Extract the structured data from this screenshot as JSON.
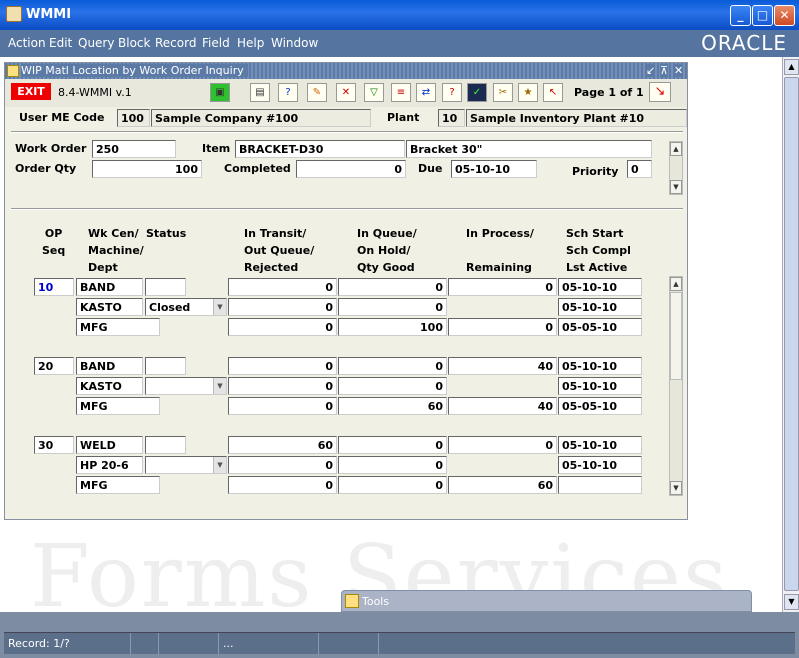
{
  "window": {
    "title": "WMMI",
    "min": "_",
    "max": "□",
    "close": "✕"
  },
  "menu": [
    "Action",
    "Edit",
    "Query",
    "Block",
    "Record",
    "Field",
    "Help",
    "Window"
  ],
  "brand": "ORACLE",
  "watermark": "Forms Services",
  "form": {
    "title": "WIP Matl Location by Work Order Inquiry",
    "title_controls": [
      "↙",
      "⊼",
      "✕"
    ],
    "exit_label": "EXIT",
    "form_code": "8.4-WMMI v.1",
    "page_indicator": "Page 1 of 1",
    "toolbar_icons": [
      "save-icon",
      "print-icon",
      "query-help-icon",
      "edit-icon",
      "delete-icon",
      "filter-icon",
      "report-icon",
      "navigate-icon",
      "help-icon",
      "select-icon",
      "tools-icon",
      "wizard-icon",
      "back-icon"
    ]
  },
  "header": {
    "user_me_code_label": "User ME Code",
    "user_me_code": "100",
    "company": "Sample Company #100",
    "plant_label": "Plant",
    "plant_code": "10",
    "plant_name": "Sample Inventory Plant #10"
  },
  "work_order": {
    "work_order_label": "Work Order",
    "work_order": "250",
    "item_label": "Item",
    "item": "BRACKET-D30",
    "item_desc": "Bracket 30\"",
    "order_qty_label": "Order Qty",
    "order_qty": "100",
    "completed_label": "Completed",
    "completed": "0",
    "due_label": "Due",
    "due": "05-10-10",
    "priority_label": "Priority",
    "priority": "0"
  },
  "columns": {
    "op": [
      "OP",
      "Seq"
    ],
    "wk": [
      "Wk Cen/",
      "Machine/",
      "Dept"
    ],
    "status": "Status",
    "transit": [
      "In Transit/",
      "Out Queue/",
      "Rejected"
    ],
    "queue": [
      "In Queue/",
      "On Hold/",
      "Qty Good"
    ],
    "process": [
      "In Process/",
      "",
      "Remaining"
    ],
    "sch": [
      "Sch Start",
      "Sch Compl",
      "Lst Active"
    ]
  },
  "ops": [
    {
      "seq": "10",
      "rows": [
        {
          "wk": "BAND",
          "status": "",
          "transit": "0",
          "queue": "0",
          "process": "0",
          "sch": "05-10-10"
        },
        {
          "wk": "KASTO",
          "status": "Closed",
          "transit": "0",
          "queue": "0",
          "process": "",
          "sch": "05-10-10"
        },
        {
          "wk": "MFG",
          "status": "",
          "transit": "0",
          "queue": "100",
          "process": "0",
          "sch": "05-05-10"
        }
      ]
    },
    {
      "seq": "20",
      "rows": [
        {
          "wk": "BAND",
          "status": "",
          "transit": "0",
          "queue": "0",
          "process": "40",
          "sch": "05-10-10"
        },
        {
          "wk": "KASTO",
          "status": "",
          "transit": "0",
          "queue": "0",
          "process": "",
          "sch": "05-10-10"
        },
        {
          "wk": "MFG",
          "status": "",
          "transit": "0",
          "queue": "60",
          "process": "40",
          "sch": "05-05-10"
        }
      ]
    },
    {
      "seq": "30",
      "rows": [
        {
          "wk": "WELD",
          "status": "",
          "transit": "60",
          "queue": "0",
          "process": "0",
          "sch": "05-10-10"
        },
        {
          "wk": "HP 20-6",
          "status": "",
          "transit": "0",
          "queue": "0",
          "process": "",
          "sch": "05-10-10"
        },
        {
          "wk": "MFG",
          "status": "",
          "transit": "0",
          "queue": "0",
          "process": "60",
          "sch": ""
        }
      ]
    }
  ],
  "tools_window": {
    "title": "Tools"
  },
  "status_bar": {
    "record": "Record: 1/?",
    "ellipsis": "..."
  }
}
